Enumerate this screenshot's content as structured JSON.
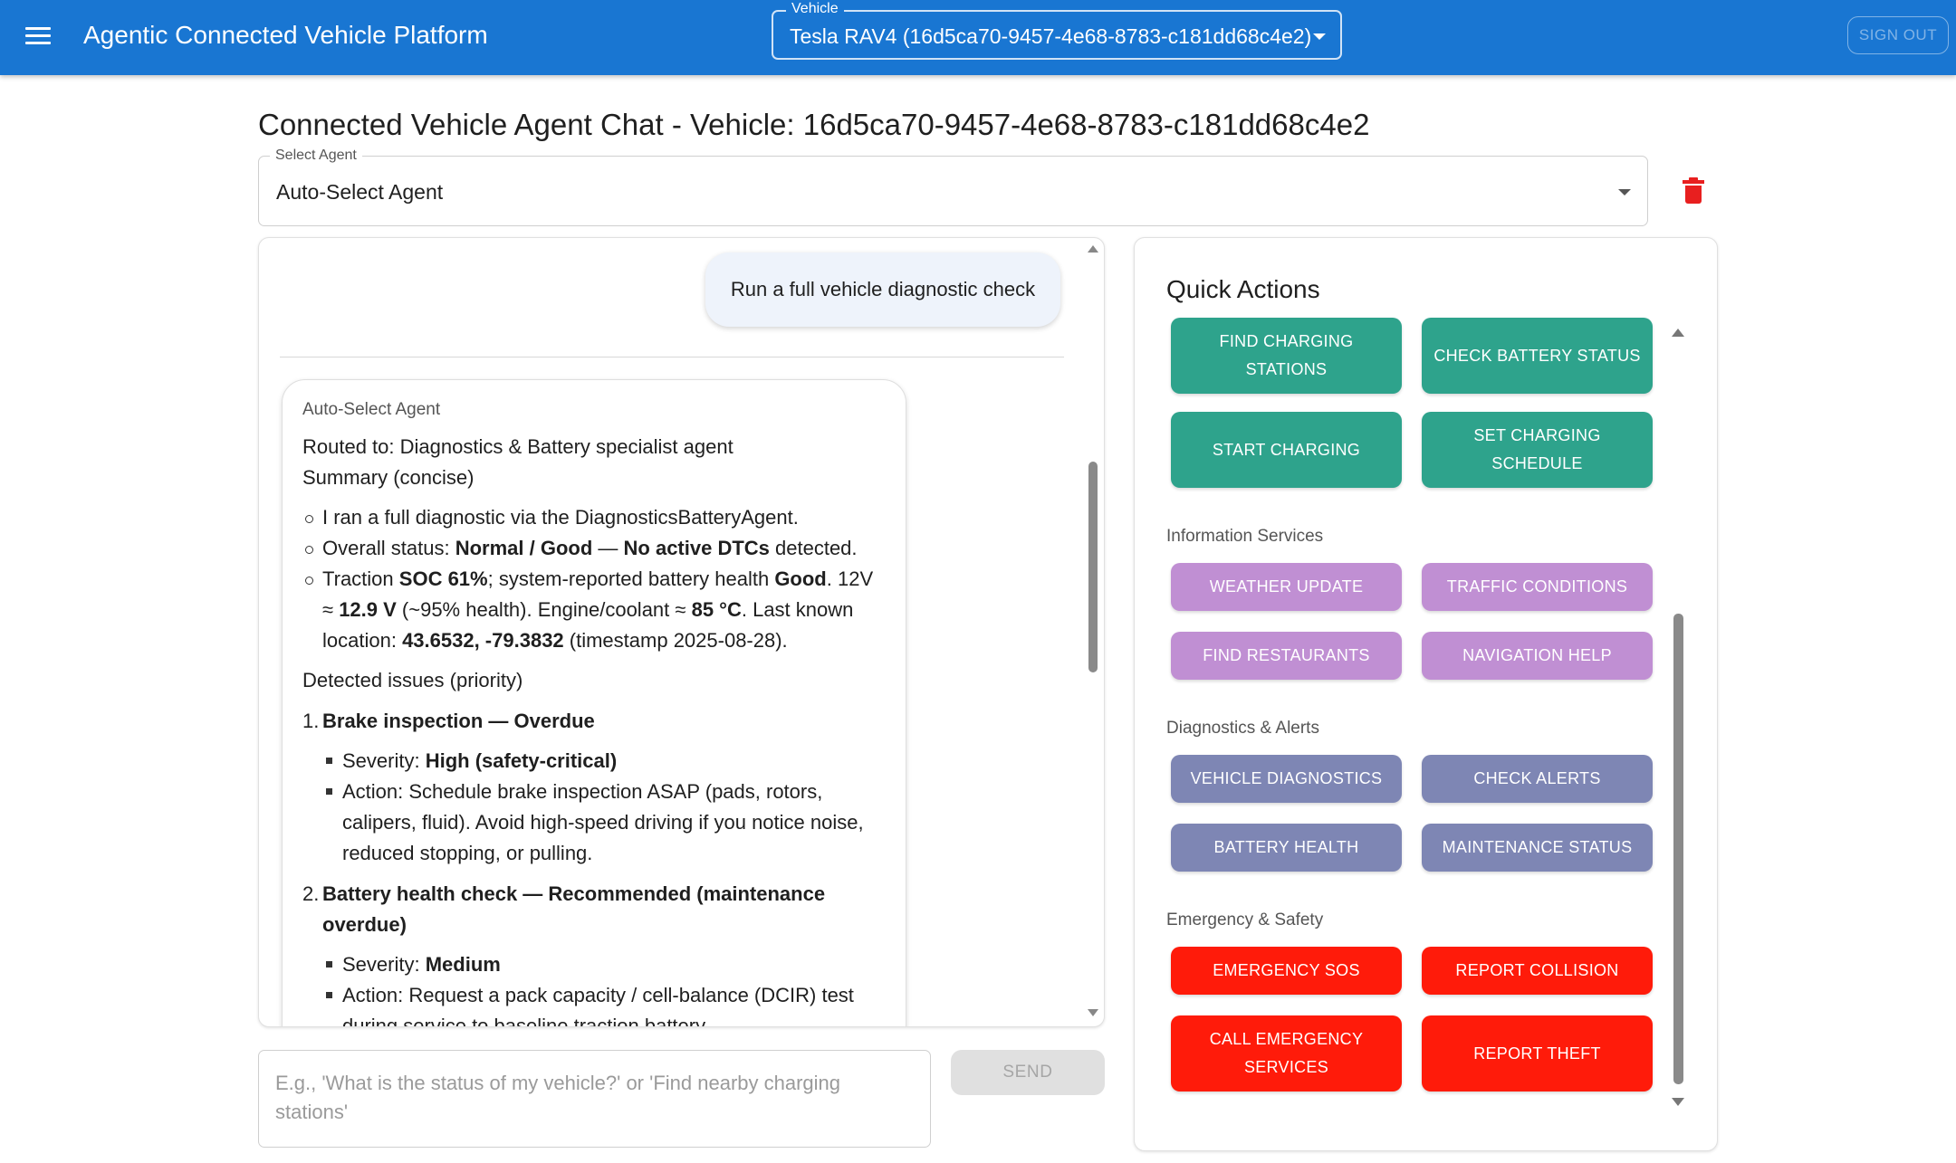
{
  "app": {
    "title": "Agentic Connected Vehicle Platform",
    "vehicle_label": "Vehicle",
    "vehicle_value": "Tesla RAV4 (16d5ca70-9457-4e68-8783-c181dd68c4e2)",
    "sign_out": "SIGN OUT",
    "accent_color": "#1976d2"
  },
  "page": {
    "title": "Connected Vehicle Agent Chat - Vehicle: 16d5ca70-9457-4e68-8783-c181dd68c4e2",
    "agent_select_label": "Select Agent",
    "agent_select_value": "Auto-Select Agent"
  },
  "chat": {
    "user_message": "Run a full vehicle diagnostic check",
    "agent_name": "Auto-Select Agent",
    "routed_to": "Routed to: Diagnostics & Battery specialist agent",
    "summary_label": "Summary (concise)",
    "summary": {
      "b1": "I ran a full diagnostic via the DiagnosticsBatteryAgent.",
      "b2_pre": "Overall status: ",
      "b2_bold1": "Normal / Good",
      "b2_mid": " — ",
      "b2_bold2": "No active DTCs",
      "b2_post": " detected.",
      "b3_pre": "Traction ",
      "b3_bold1": "SOC 61%",
      "b3_mid1": "; system-reported battery health ",
      "b3_bold2": "Good",
      "b3_mid2": ". 12V ≈ ",
      "b3_bold3": "12.9 V",
      "b3_mid3": " (~95% health). Engine/coolant ≈ ",
      "b3_bold4": "85 °C",
      "b3_mid4": ". Last known location: ",
      "b3_bold5": "43.6532, -79.3832",
      "b3_post": " (timestamp 2025-08-28)."
    },
    "issues_label": "Detected issues (priority)",
    "issue1": {
      "num": "1.",
      "title": "Brake inspection — Overdue",
      "severity_label": "Severity: ",
      "severity": "High (safety-critical)",
      "action": "Action: Schedule brake inspection ASAP (pads, rotors, calipers, fluid). Avoid high-speed driving if you notice noise, reduced stopping, or pulling."
    },
    "issue2": {
      "num": "2.",
      "title": "Battery health check — Recommended (maintenance overdue)",
      "severity_label": "Severity: ",
      "severity": "Medium",
      "action": "Action: Request a pack capacity / cell-balance (DCIR) test during service to baseline traction battery."
    },
    "input_placeholder": "E.g., 'What is the status of my vehicle?' or 'Find nearby charging stations'",
    "send_label": "SEND"
  },
  "quick_actions": {
    "title": "Quick Actions",
    "charging": {
      "find_charging_stations": "FIND CHARGING STATIONS",
      "check_battery_status": "CHECK BATTERY STATUS",
      "start_charging": "START CHARGING",
      "set_charging_schedule": "SET CHARGING SCHEDULE",
      "color": "#2ea38c"
    },
    "information": {
      "label": "Information Services",
      "weather_update": "WEATHER UPDATE",
      "traffic_conditions": "TRAFFIC CONDITIONS",
      "find_restaurants": "FIND RESTAURANTS",
      "navigation_help": "NAVIGATION HELP",
      "color": "#c08fd3"
    },
    "diagnostics": {
      "label": "Diagnostics & Alerts",
      "vehicle_diagnostics": "VEHICLE DIAGNOSTICS",
      "check_alerts": "CHECK ALERTS",
      "battery_health": "BATTERY HEALTH",
      "maintenance_status": "MAINTENANCE STATUS",
      "color": "#7e86b4"
    },
    "emergency": {
      "label": "Emergency & Safety",
      "emergency_sos": "EMERGENCY SOS",
      "report_collision": "REPORT COLLISION",
      "call_emergency_services": "CALL EMERGENCY SERVICES",
      "report_theft": "REPORT THEFT",
      "color": "#ff1b0a"
    }
  },
  "icons": {
    "menu": "menu-icon",
    "delete": "trash-icon",
    "dropdown": "chevron-down-icon"
  }
}
